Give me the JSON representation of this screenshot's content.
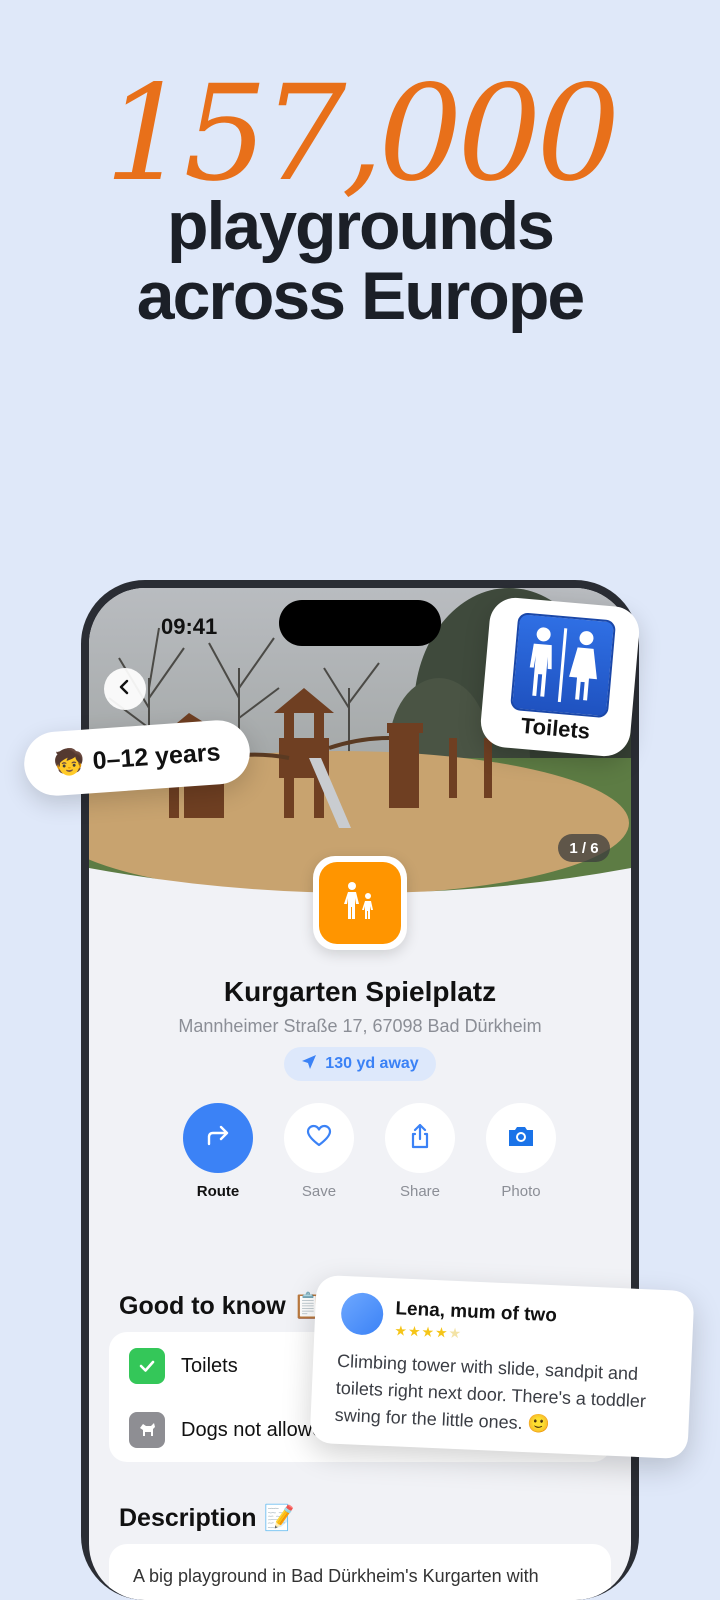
{
  "hero": {
    "number": "157,000",
    "line1": "playgrounds",
    "line2": "across Europe"
  },
  "status_bar": {
    "time": "09:41"
  },
  "photo": {
    "counter": "1 / 6"
  },
  "place": {
    "name": "Kurgarten Spielplatz",
    "address": "Mannheimer Straße 17, 67098 Bad Dürkheim",
    "distance": "130 yd away"
  },
  "actions": [
    {
      "label": "Route",
      "icon": "route-arrow-icon"
    },
    {
      "label": "Save",
      "icon": "heart-icon"
    },
    {
      "label": "Share",
      "icon": "share-icon"
    },
    {
      "label": "Photo",
      "icon": "camera-icon"
    }
  ],
  "good_to_know": {
    "title": "Good to know 📋",
    "items": [
      {
        "label": "Toilets",
        "icon": "check-icon"
      },
      {
        "label": "Dogs not allowed",
        "icon": "dog-icon"
      }
    ]
  },
  "description": {
    "title": "Description 📝",
    "text": "A big playground in Bad Dürkheim's Kurgarten with"
  },
  "age_chip": {
    "emoji": "🧒",
    "label": "0–12 years"
  },
  "toilet_badge": {
    "label": "Toilets"
  },
  "review": {
    "name": "Lena, mum of two",
    "rating": 4,
    "max_rating": 5,
    "stars_filled": "★★★★",
    "stars_empty": "★",
    "text": "Climbing tower with slide, sandpit and toilets right next door. There's a toddler swing for the little ones. 🙂"
  },
  "colors": {
    "accent_orange": "#e8701a",
    "primary_blue": "#3b82f6",
    "app_icon_orange": "#ff9500",
    "check_green": "#34c759",
    "background": "#dfe8f9"
  }
}
